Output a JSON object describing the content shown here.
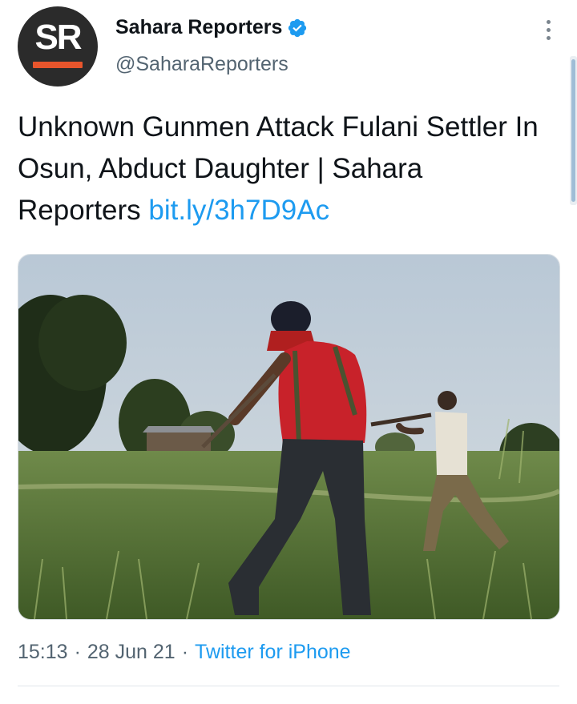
{
  "account": {
    "avatar_letters": "SR",
    "display_name": "Sahara Reporters",
    "handle": "@SaharaReporters",
    "verified": true
  },
  "tweet": {
    "text": "Unknown Gunmen Attack Fulani Settler In Osun, Abduct Daughter | Sahara Reporters ",
    "link": "bit.ly/3h7D9Ac"
  },
  "meta": {
    "time": "15:13",
    "separator": "·",
    "date": "28 Jun 21",
    "source": "Twitter for iPhone"
  },
  "icons": {
    "verified": "verified-badge-icon",
    "more": "more-options-icon"
  },
  "colors": {
    "link": "#1d9bf0",
    "secondary_text": "#536471",
    "avatar_bg": "#2b2b2b",
    "avatar_accent": "#e8552c"
  }
}
